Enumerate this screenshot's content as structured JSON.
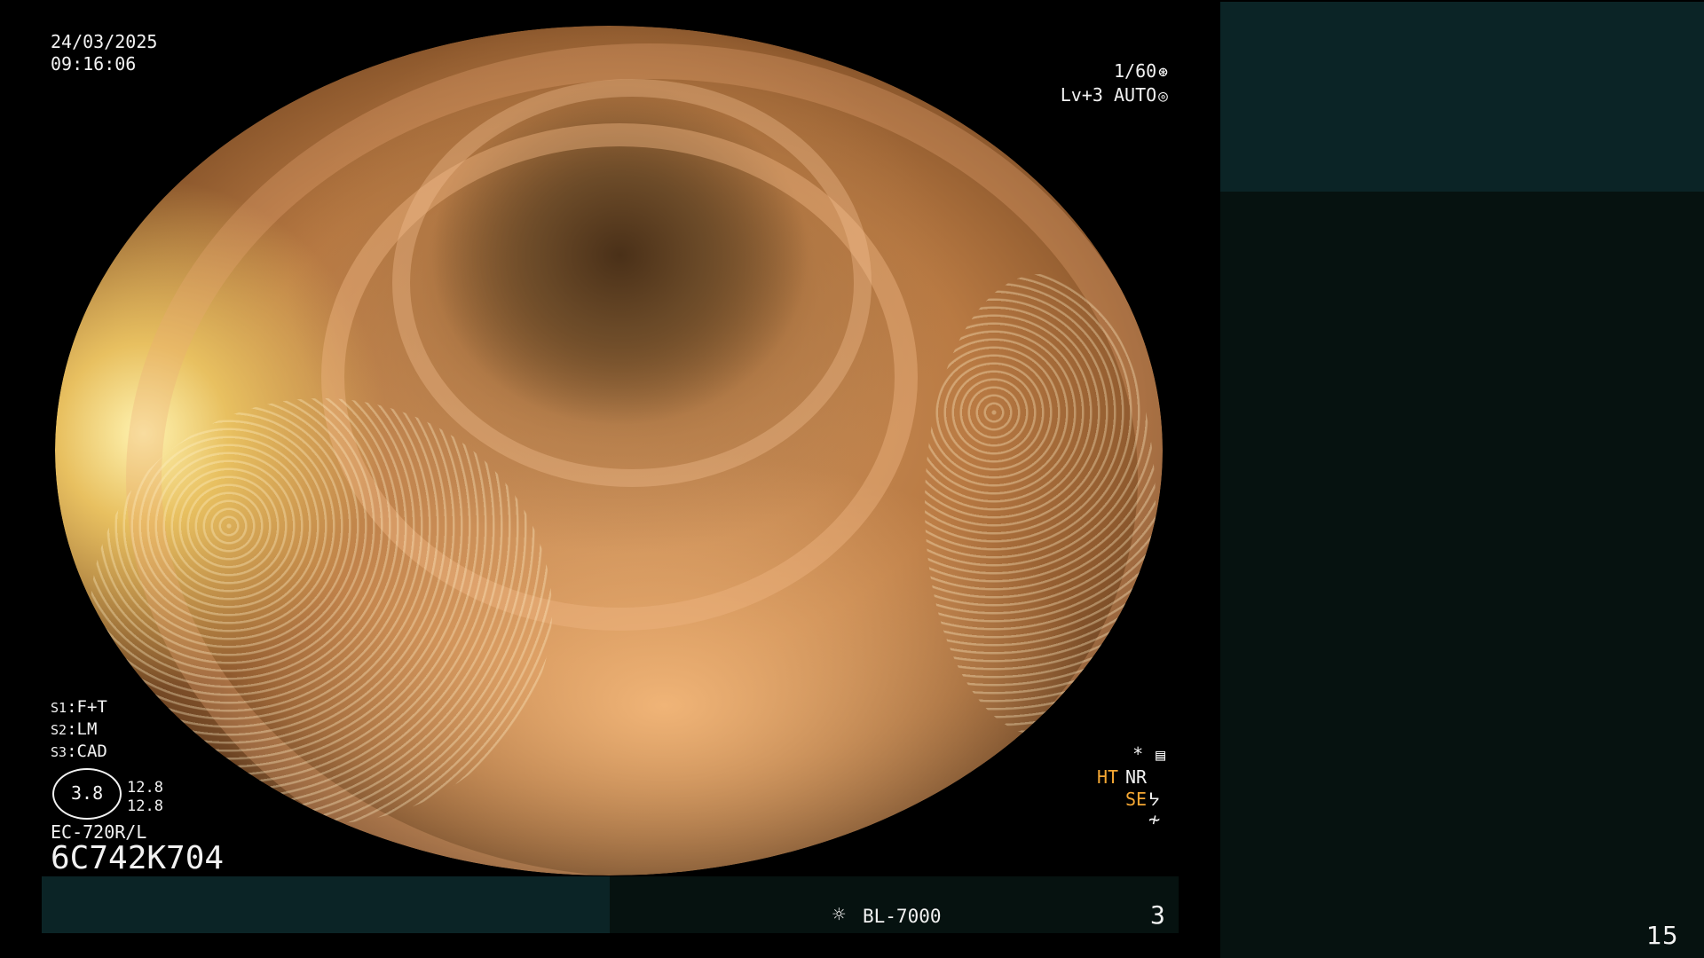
{
  "overlay": {
    "date": "24/03/2025",
    "time": "09:16:06",
    "shutter": "1/60",
    "level": "Lv+3",
    "mode": "AUTO",
    "switches": [
      {
        "key": "S1",
        "value": "F+T"
      },
      {
        "key": "S2",
        "value": "LM"
      },
      {
        "key": "S3",
        "value": "CAD"
      }
    ],
    "zoom_value": "3.8",
    "ring_top": "12.8",
    "ring_bottom": "12.8",
    "scope_model": "EC-720R/L",
    "scope_serial": "6C742K704",
    "star": "*",
    "ht": "HT",
    "nr": "NR",
    "se": "SE"
  },
  "bottom": {
    "light_source": "BL-7000",
    "frame_number": "3"
  },
  "slide": {
    "page_number": "15"
  },
  "icons": {
    "shutter": "aperture-icon",
    "auto": "auto-mode-icon",
    "menu": "settings-icon",
    "se": "structure-icon",
    "freeze": "freeze-icon",
    "light": "light-bulb-icon"
  },
  "colors": {
    "orange_label": "#f5a733",
    "dark_teal": "#0b2426",
    "darker_panel": "#061210"
  }
}
